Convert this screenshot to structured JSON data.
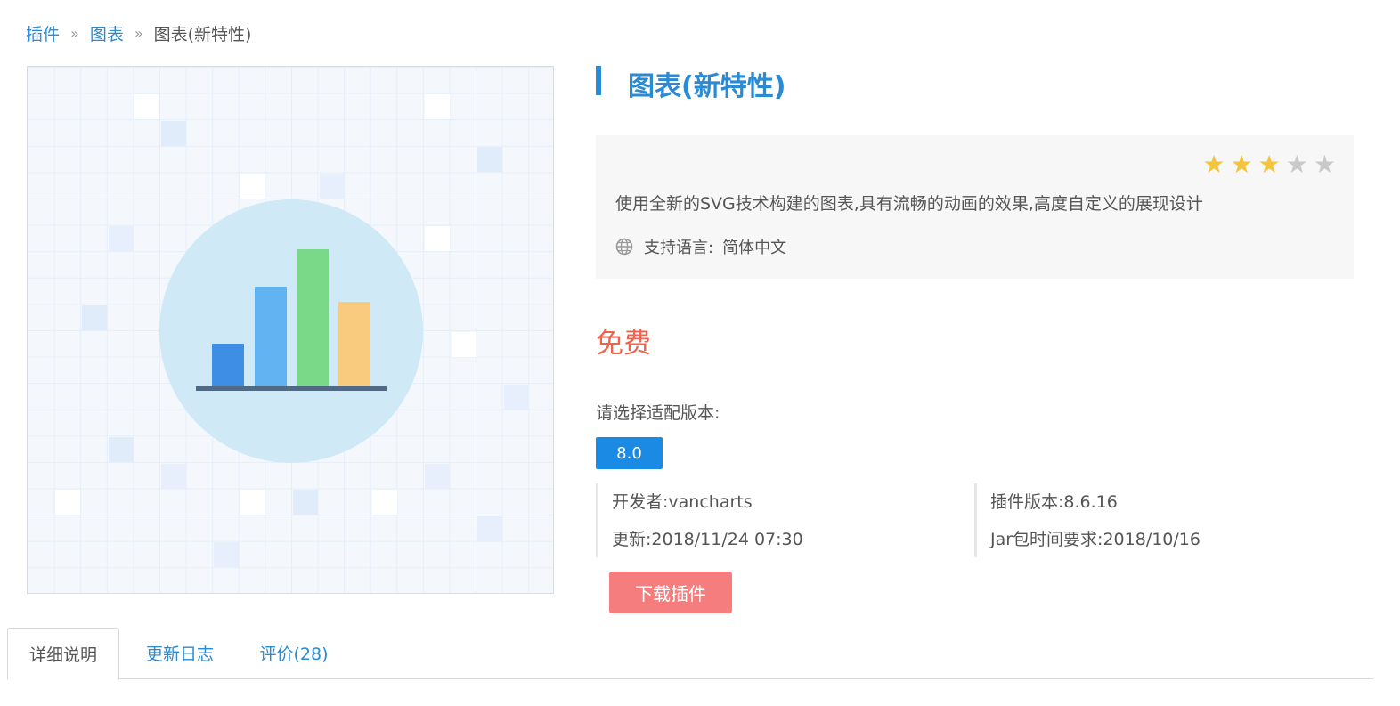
{
  "breadcrumb": {
    "items": [
      "插件",
      "图表"
    ],
    "separator": "»",
    "current": "图表(新特性)"
  },
  "plugin": {
    "title": "图表(新特性)",
    "rating": 3,
    "rating_max": 5,
    "description": "使用全新的SVG技术构建的图表,具有流畅的动画的效果,高度自定义的展现设计",
    "language_label": "支持语言:",
    "language_value": "简体中文",
    "price": "免费",
    "select_version_label": "请选择适配版本:",
    "version_option": "8.0",
    "developer": "开发者:vancharts",
    "updated": "更新:2018/11/24 07:30",
    "plugin_version": "插件版本:8.6.16",
    "jar_requirement": "Jar包时间要求:2018/10/16",
    "download_label": "下载插件"
  },
  "tabs": [
    "详细说明",
    "更新日志",
    "评价(28)"
  ],
  "colors": {
    "link": "#2a8ad4",
    "price": "#f0624d",
    "version_button": "#1a8ae5",
    "download_button": "#f57d7d",
    "star_on": "#f6c43a",
    "star_off": "#c9c9c9"
  },
  "preview_icon": "bar-chart-icon"
}
